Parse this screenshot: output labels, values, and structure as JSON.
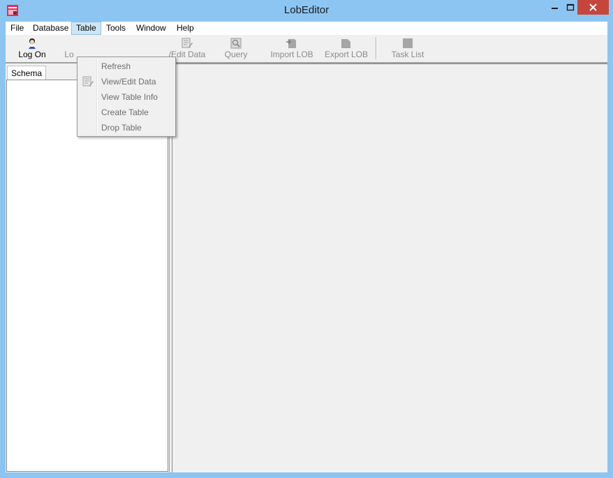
{
  "window": {
    "title": "LobEditor"
  },
  "menubar": {
    "items": [
      {
        "label": "File"
      },
      {
        "label": "Database"
      },
      {
        "label": "Table"
      },
      {
        "label": "Tools"
      },
      {
        "label": "Window"
      },
      {
        "label": "Help"
      }
    ]
  },
  "toolbar": {
    "buttons": [
      {
        "label": "Log On",
        "icon": "user-icon",
        "enabled": true
      },
      {
        "label": "Lo",
        "icon": "logoff-icon",
        "enabled": false
      },
      {
        "label": "/Edit Data",
        "icon": "edit-data-icon",
        "enabled": false
      },
      {
        "label": "Query",
        "icon": "query-icon",
        "enabled": false
      },
      {
        "label": "Import LOB",
        "icon": "import-icon",
        "enabled": false
      },
      {
        "label": "Export LOB",
        "icon": "export-icon",
        "enabled": false
      },
      {
        "label": "Task List",
        "icon": "task-list-icon",
        "enabled": false
      }
    ]
  },
  "left_pane": {
    "tab_label": "Schema"
  },
  "table_menu": {
    "items": [
      {
        "label": "Refresh",
        "enabled": false
      },
      {
        "label": "View/Edit Data",
        "enabled": false,
        "icon": "edit-data-icon"
      },
      {
        "label": "View Table Info",
        "enabled": false
      },
      {
        "label": "Create Table",
        "enabled": false
      },
      {
        "label": "Drop Table",
        "enabled": false
      }
    ]
  },
  "colors": {
    "title_bar": "#8cc5f2",
    "close_button": "#c7463c",
    "menu_highlight": "#cde6f7",
    "disabled_text": "#8a8a8a"
  }
}
